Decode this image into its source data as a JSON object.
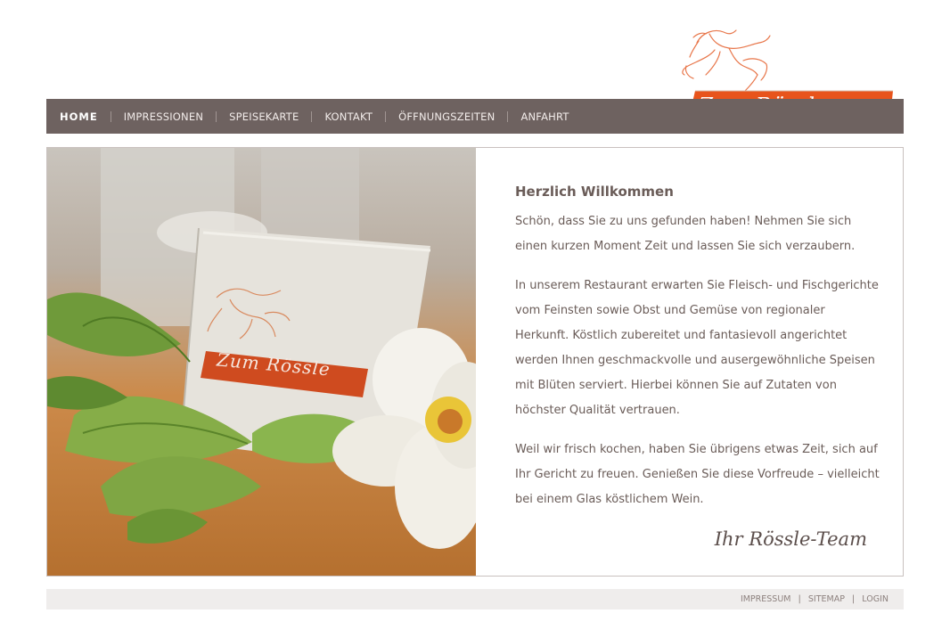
{
  "brand": {
    "name": "Zum Rössle",
    "accent_color": "#e8541c",
    "nav_color": "#6e6260"
  },
  "nav": {
    "items": [
      {
        "label": "HOME",
        "active": true
      },
      {
        "label": "IMPRESSIONEN",
        "active": false
      },
      {
        "label": "SPEISEKARTE",
        "active": false
      },
      {
        "label": "KONTAKT",
        "active": false
      },
      {
        "label": "ÖFFNUNGSZEITEN",
        "active": false
      },
      {
        "label": "ANFAHRT",
        "active": false
      }
    ]
  },
  "main": {
    "heading": "Herzlich Willkommen",
    "paragraphs": [
      "Schön, dass Sie zu uns gefunden haben! Nehmen Sie sich einen kurzen Moment Zeit und lassen Sie sich verzaubern.",
      "In unserem Restaurant erwarten Sie Fleisch- und Fischgerichte vom Feinsten sowie Obst und Gemüse von regionaler Herkunft. Köstlich zubereitet und fantasievoll angerichtet werden Ihnen geschmackvolle und ausergewöhnliche Speisen mit Blüten serviert. Hierbei können Sie auf Zutaten von höchster Qualität vertrauen.",
      "Weil wir frisch kochen, haben Sie übrigens etwas Zeit, sich auf Ihr Gericht zu freuen. Genießen Sie diese Vorfreude – vielleicht bei einem Glas köstlichem Wein."
    ],
    "signature": "Ihr Rössle-Team"
  },
  "footer": {
    "links": [
      "IMPRESSUM",
      "SITEMAP",
      "LOGIN"
    ]
  }
}
